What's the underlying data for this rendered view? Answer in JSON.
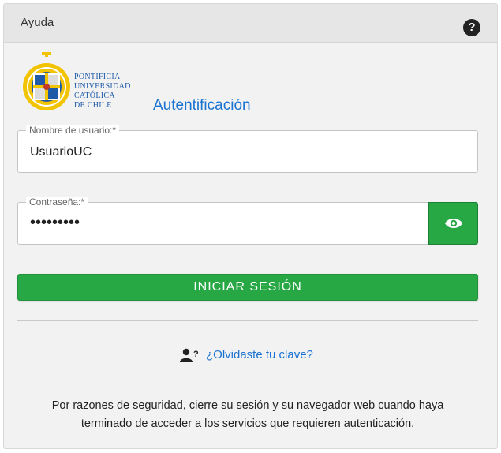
{
  "header": {
    "title": "Ayuda",
    "help_icon": "question-circle-icon",
    "help_glyph": "?"
  },
  "brand": {
    "logo_icon": "university-crest-icon",
    "name_lines": [
      "PONTIFICIA",
      "UNIVERSIDAD",
      "CATÓLICA",
      "DE CHILE"
    ],
    "auth_title": "Autentificación",
    "accent_color": "#1b73d1"
  },
  "form": {
    "username": {
      "label": "Nombre de usuario:*",
      "value": "UsuarioUC"
    },
    "password": {
      "label": "Contraseña:*",
      "masked_value": "•••••••••",
      "toggle_icon": "eye-icon"
    },
    "submit_label": "INICIAR SESIÓN",
    "submit_color": "#28a745"
  },
  "forgot": {
    "icon": "user-question-icon",
    "link_text": "¿Olvidaste tu clave?"
  },
  "notice": {
    "line1": "Por razones de seguridad, cierre su sesión y su navegador web cuando haya",
    "line2": "terminado de acceder a los servicios que requieren autenticación."
  }
}
